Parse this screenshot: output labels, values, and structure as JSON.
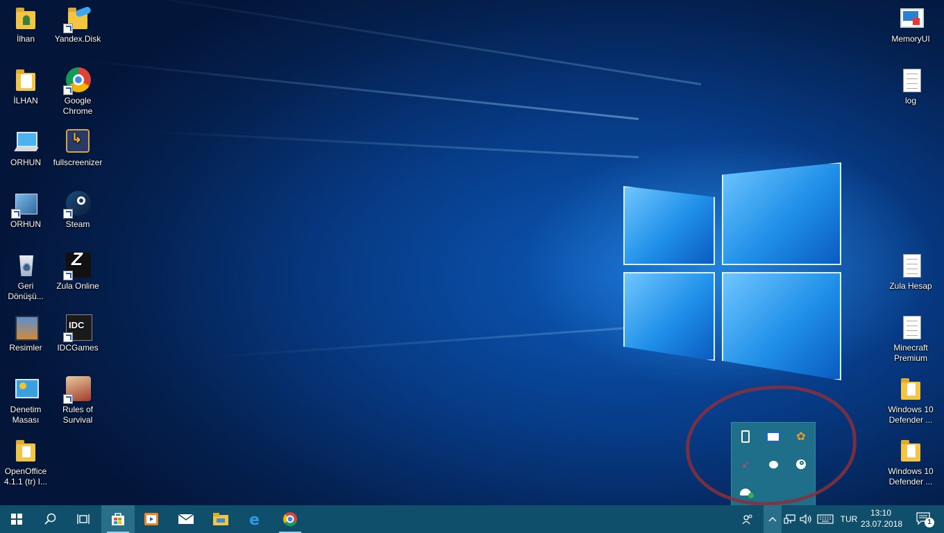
{
  "desktop": {
    "left_icons": [
      {
        "label": "İlhan",
        "icon": "user-folder-icon"
      },
      {
        "label": "Yandex.Disk",
        "icon": "yandex-disk-icon"
      },
      {
        "label": "İLHAN",
        "icon": "folder-icon"
      },
      {
        "label": "Google Chrome",
        "icon": "chrome-icon"
      },
      {
        "label": "ORHUN",
        "icon": "computer-icon"
      },
      {
        "label": "fullscreenizer",
        "icon": "fullscreenizer-icon"
      },
      {
        "label": "ORHUN",
        "icon": "network-image-icon"
      },
      {
        "label": "Steam",
        "icon": "steam-icon"
      },
      {
        "label": "Geri Dönüşü...",
        "icon": "recycle-bin-icon"
      },
      {
        "label": "Zula Online",
        "icon": "zula-icon"
      },
      {
        "label": "Resimler",
        "icon": "pictures-icon"
      },
      {
        "label": "IDCGames",
        "icon": "idcgames-icon"
      },
      {
        "label": "Denetim Masası",
        "icon": "control-panel-icon"
      },
      {
        "label": "Rules of Survival",
        "icon": "rules-of-survival-icon"
      },
      {
        "label": "OpenOffice 4.1.1 (tr) I...",
        "icon": "openoffice-folder-icon"
      }
    ],
    "right_icons": [
      {
        "label": "MemoryUI",
        "icon": "memoryui-icon"
      },
      {
        "label": "log",
        "icon": "text-document-icon"
      },
      {
        "label": "Zula Hesap",
        "icon": "text-document-icon"
      },
      {
        "label": "Minecraft Premium",
        "icon": "text-document-icon"
      },
      {
        "label": "Windows 10 Defender ...",
        "icon": "folder-icon"
      },
      {
        "label": "Windows 10 Defender ...",
        "icon": "folder-icon"
      }
    ]
  },
  "tray_popup": {
    "icons": [
      "usb-drive-icon",
      "display-adapter-icon",
      "flower-app-icon",
      "rocket-app-icon",
      "cloud-bubble-icon",
      "steam-tray-icon",
      "defender-shield-icon"
    ]
  },
  "taskbar": {
    "pinned": [
      "start-icon",
      "search-icon",
      "task-view-icon",
      "store-icon",
      "media-player-icon",
      "mail-icon",
      "file-explorer-icon",
      "edge-icon",
      "chrome-icon"
    ],
    "language": "TUR",
    "time": "13:10",
    "date": "23.07.2018",
    "notification_count": "1"
  },
  "colors": {
    "taskbar": "#0f4f6b",
    "tray_popup": "#1f6f8b",
    "annotation": "#8a2f3c"
  }
}
